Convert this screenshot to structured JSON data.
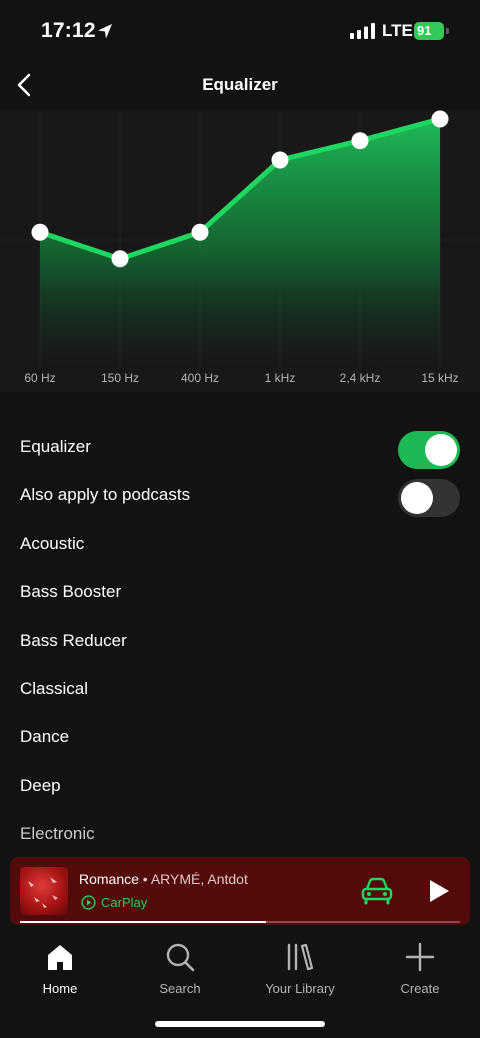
{
  "status_bar": {
    "time": "17:12",
    "network": "LTE",
    "battery": "91"
  },
  "header": {
    "title": "Equalizer"
  },
  "equalizer": {
    "bands": [
      {
        "label": "60 Hz",
        "gain_level": 0.53
      },
      {
        "label": "150 Hz",
        "gain_level": 0.42
      },
      {
        "label": "400 Hz",
        "gain_level": 0.53
      },
      {
        "label": "1 kHz",
        "gain_level": 0.83
      },
      {
        "label": "2,4 kHz",
        "gain_level": 0.91
      },
      {
        "label": "15 kHz",
        "gain_level": 1.0
      }
    ],
    "accent_color": "#1ed760"
  },
  "settings": {
    "equalizer_toggle": {
      "label": "Equalizer",
      "on": true
    },
    "podcasts_toggle": {
      "label": "Also apply to podcasts",
      "on": false
    },
    "presets": [
      "Acoustic",
      "Bass Booster",
      "Bass Reducer",
      "Classical",
      "Dance",
      "Deep",
      "Electronic"
    ]
  },
  "now_playing": {
    "title": "Romance",
    "separator": " • ",
    "artists": "ARYMÉ, Antdot",
    "device": "CarPlay",
    "progress": 0.56,
    "background_color": "#520a0a"
  },
  "bottom_nav": {
    "items": [
      {
        "label": "Home",
        "icon": "home-icon",
        "active": true
      },
      {
        "label": "Search",
        "icon": "search-icon",
        "active": false
      },
      {
        "label": "Your Library",
        "icon": "library-icon",
        "active": false
      },
      {
        "label": "Create",
        "icon": "plus-icon",
        "active": false
      }
    ]
  }
}
